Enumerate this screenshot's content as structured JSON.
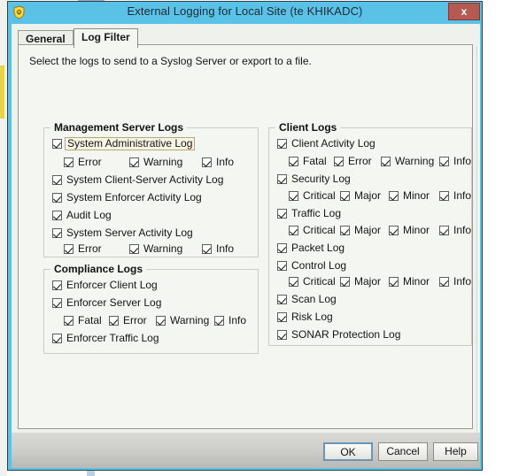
{
  "window": {
    "title": "External Logging for Local Site (te KHIKADC)",
    "icon": "shield-icon",
    "close_label": "x",
    "titlebar_color": "#5bc2e7",
    "close_color": "#b55a52"
  },
  "tabs": [
    {
      "id": "general",
      "label": "General",
      "selected": false
    },
    {
      "id": "log-filter",
      "label": "Log Filter",
      "selected": true
    }
  ],
  "panel": {
    "hint": "Select the logs to send to a Syslog Server or export to a file."
  },
  "groups": {
    "management": {
      "title": "Management Server Logs",
      "items": [
        {
          "label": "System Administrative Log",
          "checked": true,
          "focused": true
        },
        {
          "label": "System Client-Server Activity Log",
          "checked": true,
          "focused": false
        },
        {
          "label": "System Enforcer Activity Log",
          "checked": true,
          "focused": false
        },
        {
          "label": "Audit Log",
          "checked": true,
          "focused": false
        },
        {
          "label": "System Server Activity Log",
          "checked": true,
          "focused": false
        }
      ],
      "sub_admin": [
        {
          "label": "Error",
          "checked": true
        },
        {
          "label": "Warning",
          "checked": true
        },
        {
          "label": "Info",
          "checked": true
        }
      ],
      "sub_server_activity": [
        {
          "label": "Error",
          "checked": true
        },
        {
          "label": "Warning",
          "checked": true
        },
        {
          "label": "Info",
          "checked": true
        }
      ]
    },
    "compliance": {
      "title": "Compliance Logs",
      "items": [
        {
          "label": "Enforcer Client Log",
          "checked": true
        },
        {
          "label": "Enforcer Server Log",
          "checked": true
        },
        {
          "label": "Enforcer Traffic Log",
          "checked": true
        }
      ],
      "sub_enforcer_server": [
        {
          "label": "Fatal",
          "checked": true
        },
        {
          "label": "Error",
          "checked": true
        },
        {
          "label": "Warning",
          "checked": true
        },
        {
          "label": "Info",
          "checked": true
        }
      ]
    },
    "client": {
      "title": "Client Logs",
      "items": [
        {
          "label": "Client Activity Log",
          "checked": true
        },
        {
          "label": "Security Log",
          "checked": true
        },
        {
          "label": "Traffic Log",
          "checked": true
        },
        {
          "label": "Packet Log",
          "checked": true
        },
        {
          "label": "Control Log",
          "checked": true
        },
        {
          "label": "Scan Log",
          "checked": true
        },
        {
          "label": "Risk Log",
          "checked": true
        },
        {
          "label": "SONAR Protection Log",
          "checked": true
        }
      ],
      "sub_client_activity": [
        {
          "label": "Fatal",
          "checked": true
        },
        {
          "label": "Error",
          "checked": true
        },
        {
          "label": "Warning",
          "checked": true
        },
        {
          "label": "Info",
          "checked": true
        }
      ],
      "sub_security": [
        {
          "label": "Critical",
          "checked": true
        },
        {
          "label": "Major",
          "checked": true
        },
        {
          "label": "Minor",
          "checked": true
        },
        {
          "label": "Info",
          "checked": true
        }
      ],
      "sub_traffic": [
        {
          "label": "Critical",
          "checked": true
        },
        {
          "label": "Major",
          "checked": true
        },
        {
          "label": "Minor",
          "checked": true
        },
        {
          "label": "Info",
          "checked": true
        }
      ],
      "sub_control": [
        {
          "label": "Critical",
          "checked": true
        },
        {
          "label": "Major",
          "checked": true
        },
        {
          "label": "Minor",
          "checked": true
        },
        {
          "label": "Info",
          "checked": true
        }
      ]
    }
  },
  "buttons": [
    {
      "id": "ok",
      "label": "OK",
      "default": true
    },
    {
      "id": "cancel",
      "label": "Cancel",
      "default": false
    },
    {
      "id": "help",
      "label": "Help",
      "default": false
    }
  ]
}
